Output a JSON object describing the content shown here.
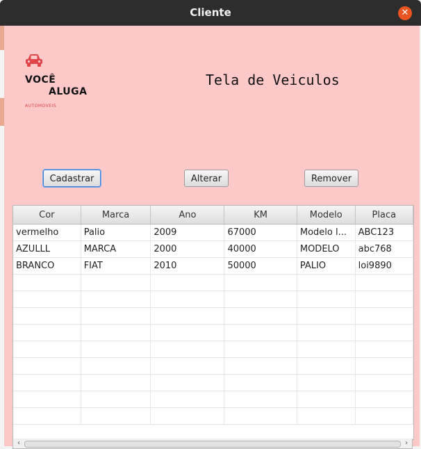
{
  "window": {
    "title": "Cliente"
  },
  "header": {
    "logo_line1": "VOCÊ",
    "logo_line2": "ALUGA",
    "logo_line3": "AUTOMOVEIS",
    "title": "Tela de Veiculos"
  },
  "buttons": {
    "cadastrar": "Cadastrar",
    "alterar": "Alterar",
    "remover": "Remover"
  },
  "table": {
    "columns": [
      "Cor",
      "Marca",
      "Ano",
      "KM",
      "Modelo",
      "Placa"
    ],
    "rows": [
      [
        "vermelho",
        "Palio",
        "2009",
        "67000",
        "Modelo l...",
        "ABC123"
      ],
      [
        "AZULLL",
        "MARCA",
        "2000",
        "40000",
        "MODELO",
        "abc768"
      ],
      [
        "BRANCO",
        "FIAT",
        "2010",
        "50000",
        "PALIO",
        "loi9890"
      ]
    ],
    "empty_rows": 9
  },
  "colors": {
    "titlebar": "#2d2d2d",
    "content_background": "#fdc8c8",
    "close_button": "#e95420",
    "logo_accent": "#e0454a"
  },
  "icons": {
    "close": "close-icon",
    "car": "car-icon",
    "scroll_left": "chevron-left-icon",
    "scroll_right": "chevron-right-icon"
  }
}
